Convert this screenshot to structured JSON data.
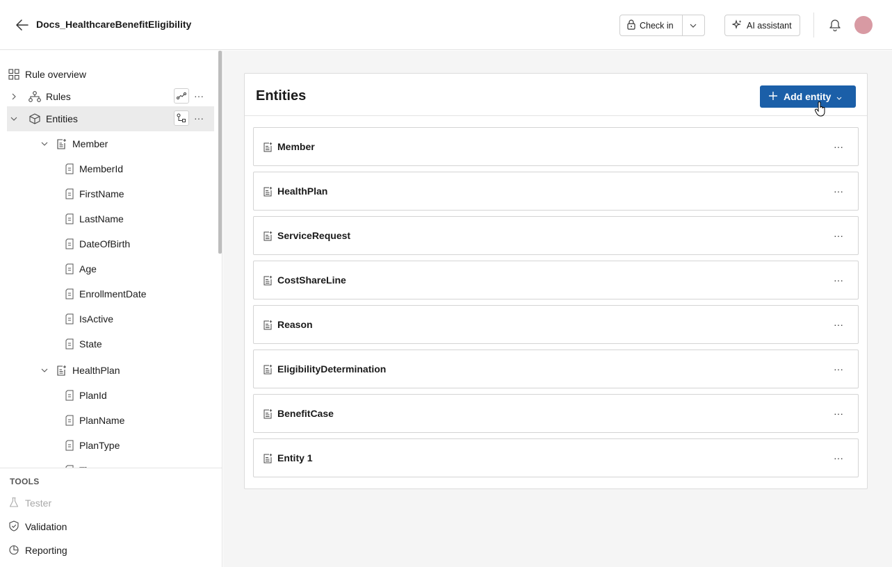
{
  "header": {
    "title": "Docs_HealthcareBenefitEligibility",
    "checkin_label": "Check in",
    "ai_label": "AI assistant"
  },
  "sidebar": {
    "rule_overview": "Rule overview",
    "rules": "Rules",
    "entities": "Entities",
    "tree": [
      {
        "label": "Member",
        "type": "entity"
      },
      {
        "label": "MemberId",
        "type": "field"
      },
      {
        "label": "FirstName",
        "type": "field"
      },
      {
        "label": "LastName",
        "type": "field"
      },
      {
        "label": "DateOfBirth",
        "type": "field"
      },
      {
        "label": "Age",
        "type": "field"
      },
      {
        "label": "EnrollmentDate",
        "type": "field"
      },
      {
        "label": "IsActive",
        "type": "field"
      },
      {
        "label": "State",
        "type": "field"
      },
      {
        "label": "HealthPlan",
        "type": "entity"
      },
      {
        "label": "PlanId",
        "type": "field"
      },
      {
        "label": "PlanName",
        "type": "field"
      },
      {
        "label": "PlanType",
        "type": "field"
      },
      {
        "label": "Ti",
        "type": "field"
      }
    ],
    "tools_title": "TOOLS",
    "tools": [
      {
        "label": "Tester",
        "icon": "flask-icon",
        "disabled": true
      },
      {
        "label": "Validation",
        "icon": "shield-check-icon",
        "disabled": false
      },
      {
        "label": "Reporting",
        "icon": "pie-chart-icon",
        "disabled": false
      }
    ]
  },
  "main": {
    "title": "Entities",
    "add_label": "Add entity",
    "entities": [
      "Member",
      "HealthPlan",
      "ServiceRequest",
      "CostShareLine",
      "Reason",
      "EligibilityDetermination",
      "BenefitCase",
      "Entity 1"
    ]
  },
  "colors": {
    "primary": "#1b5fa8",
    "avatar": "#d89aa3",
    "selected_row": "#ebebeb"
  }
}
